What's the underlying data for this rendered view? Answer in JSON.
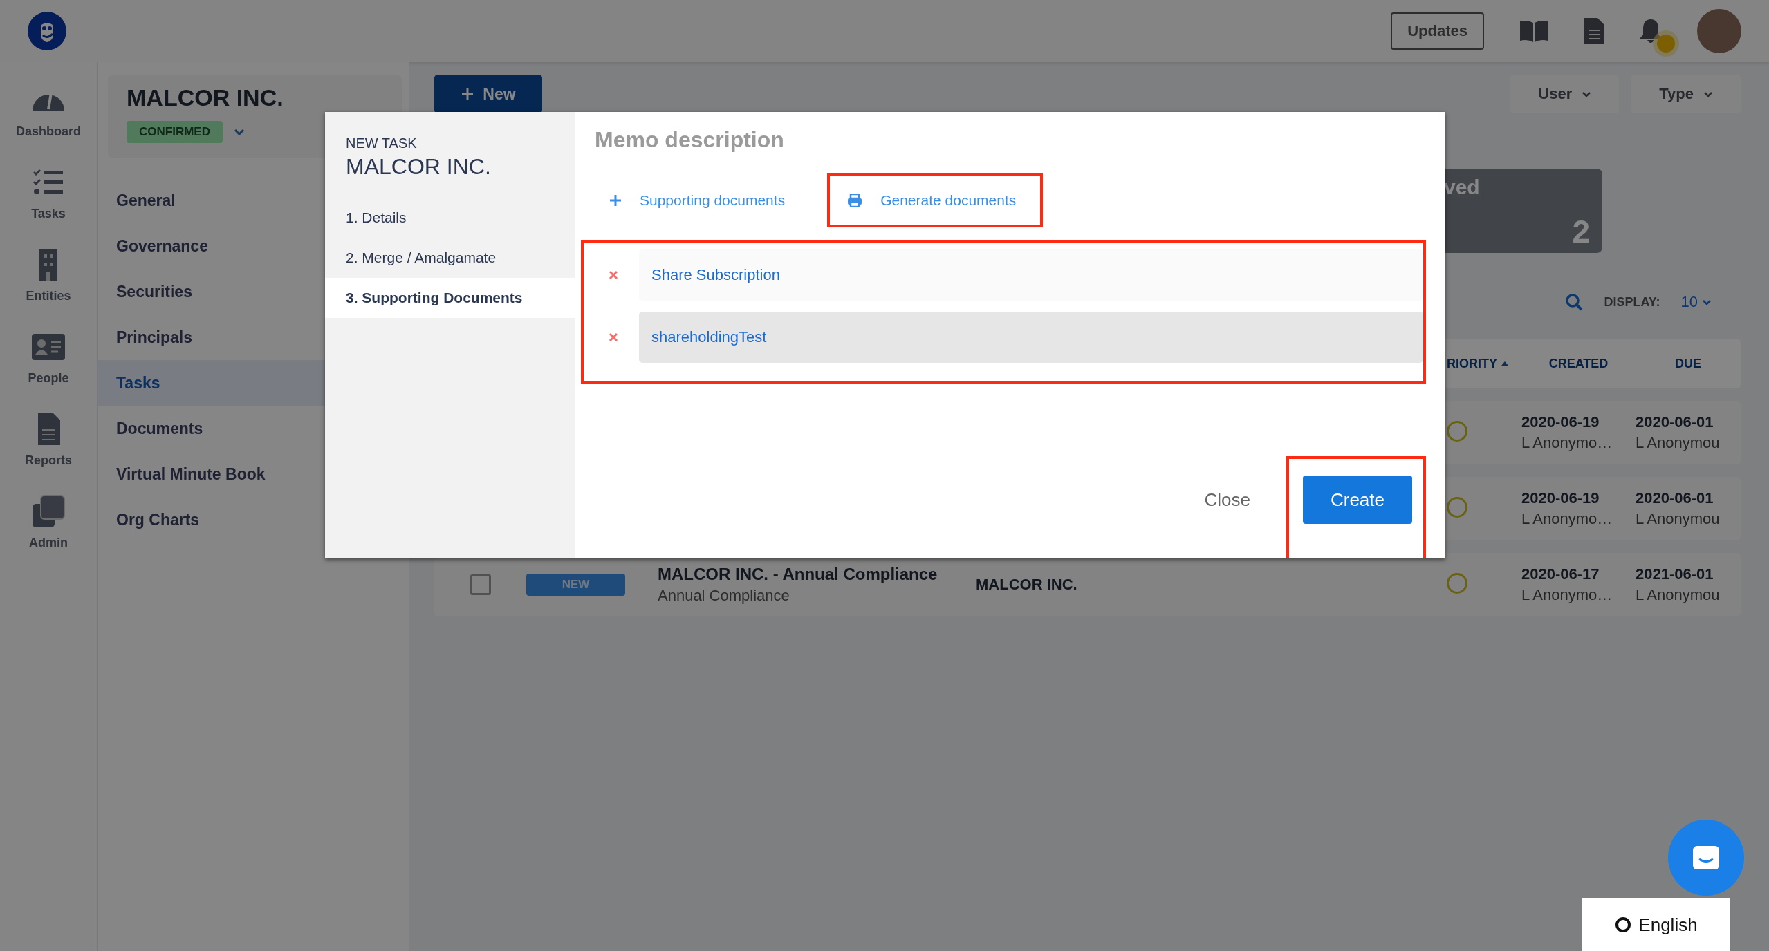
{
  "top_bar": {
    "updates_button": "Updates"
  },
  "nav_rail": [
    {
      "kind": "dashboard",
      "label": "Dashboard"
    },
    {
      "kind": "tasks",
      "label": "Tasks"
    },
    {
      "kind": "entities",
      "label": "Entities"
    },
    {
      "kind": "people",
      "label": "People"
    },
    {
      "kind": "reports",
      "label": "Reports"
    },
    {
      "kind": "admin",
      "label": "Admin"
    }
  ],
  "entity": {
    "name": "MALCOR INC.",
    "status": "CONFIRMED"
  },
  "sidebar": {
    "items": [
      {
        "label": "General",
        "selected": false
      },
      {
        "label": "Governance",
        "selected": false
      },
      {
        "label": "Securities",
        "selected": false
      },
      {
        "label": "Principals",
        "selected": false
      },
      {
        "label": "Tasks",
        "selected": true
      },
      {
        "label": "Documents",
        "selected": false
      },
      {
        "label": "Virtual Minute Book",
        "selected": false
      },
      {
        "label": "Org Charts",
        "selected": false
      }
    ]
  },
  "toolbar": {
    "new_button": "New",
    "filters": [
      "User",
      "Type"
    ]
  },
  "stat_card": {
    "label": "ved",
    "count": "2"
  },
  "table": {
    "display_label": "DISPLAY:",
    "page_size": "10",
    "columns": [
      "RIORITY",
      "CREATED",
      "DUE"
    ],
    "rows": [
      {
        "created": "2020-06-19",
        "created_by": "L Anonymo…",
        "due": "2020-06-01",
        "due_by": "L Anonymou"
      },
      {
        "created": "2020-06-19",
        "created_by": "L Anonymo…",
        "due": "2020-06-01",
        "due_by": "L Anonymou"
      },
      {
        "checked": false,
        "status": "NEW",
        "title": "MALCOR INC. - Annual Compliance",
        "subtitle": "Annual Compliance",
        "entity": "MALCOR INC.",
        "created": "2020-06-17",
        "created_by": "L Anonymo…",
        "due": "2021-06-01",
        "due_by": "L Anonymou"
      }
    ]
  },
  "modal": {
    "label": "NEW TASK",
    "title": "MALCOR INC.",
    "steps": [
      {
        "label": "1. Details",
        "selected": false
      },
      {
        "label": "2. Merge / Amalgamate",
        "selected": false
      },
      {
        "label": "3. Supporting Documents",
        "selected": true
      }
    ],
    "heading": "Memo description",
    "actions": [
      {
        "kind": "add",
        "label": "Supporting documents",
        "highlighted": false
      },
      {
        "kind": "print",
        "label": "Generate documents",
        "highlighted": true
      }
    ],
    "documents": {
      "highlighted": true,
      "items": [
        {
          "name": "Share Subscription",
          "hovered": false
        },
        {
          "name": "shareholdingTest",
          "hovered": true
        }
      ]
    },
    "buttons": [
      {
        "kind": "secondary",
        "label": "Close",
        "highlighted": false
      },
      {
        "kind": "primary",
        "label": "Create",
        "highlighted": true
      }
    ]
  },
  "language_button": "English"
}
